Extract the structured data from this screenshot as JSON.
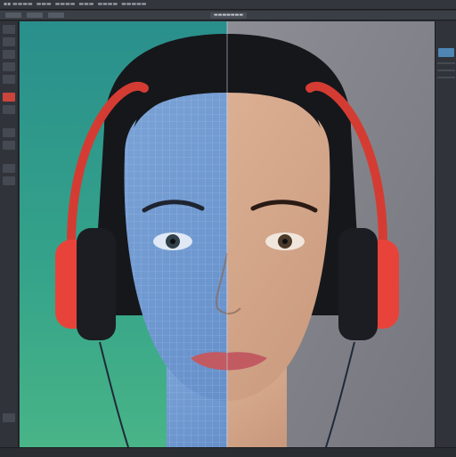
{
  "menubar": {
    "items": [
      "▪▪ ▬▬▬▬",
      "▬▬▬",
      "▬▬▬▬",
      "▬▬▬",
      "▬▬▬▬",
      "▬▬▬▬▬"
    ]
  },
  "document": {
    "tab_label": "▬▬▬▬▬▬▬"
  },
  "colors": {
    "accent_tool": "#c9453c",
    "panel_accent": "#4f86b3",
    "canvas_left_bg": "#2f9a8d",
    "canvas_right_bg": "#8a8c93",
    "headphone_red": "#e8433a",
    "hair": "#15171b"
  },
  "icons": [
    "move-tool-icon",
    "selection-tool-icon",
    "brush-tool-icon",
    "crop-tool-icon",
    "layers-panel-icon"
  ]
}
